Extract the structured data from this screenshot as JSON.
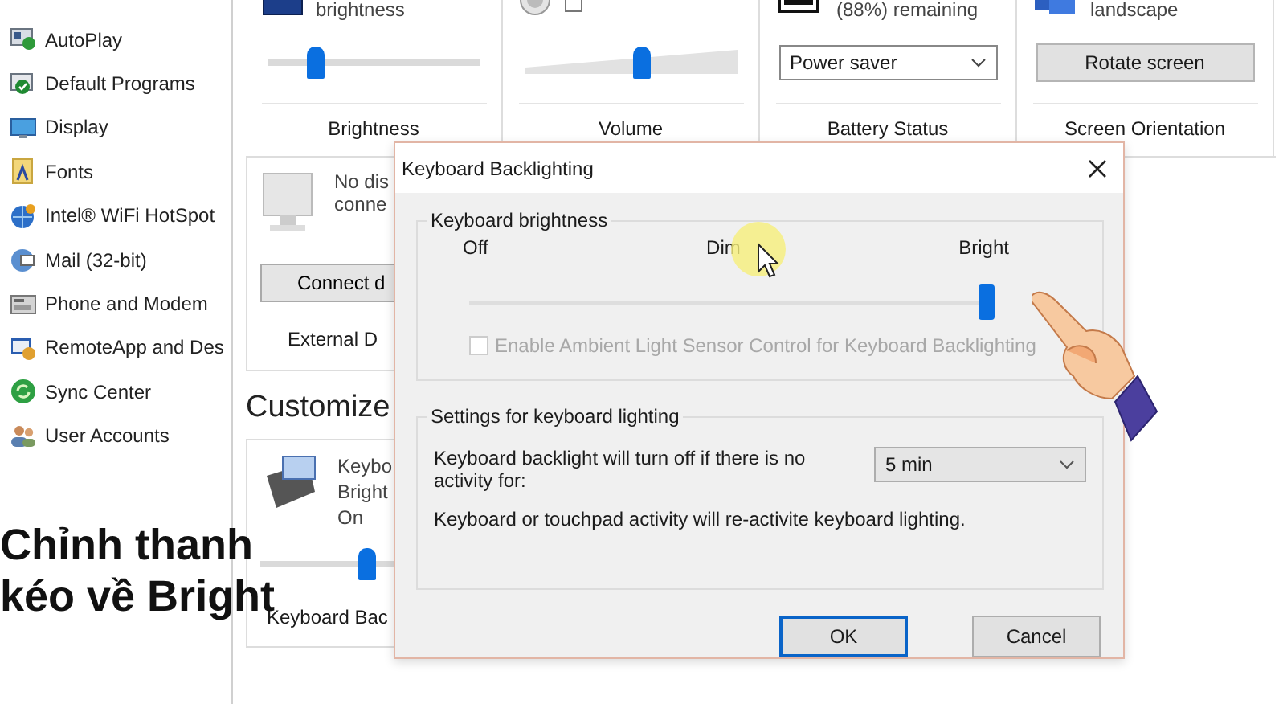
{
  "sidebar": {
    "items": [
      {
        "label": "AutoPlay"
      },
      {
        "label": "Default Programs"
      },
      {
        "label": "Display"
      },
      {
        "label": "Fonts"
      },
      {
        "label": "Intel® WiFi HotSpot"
      },
      {
        "label": "Mail (32-bit)"
      },
      {
        "label": "Phone and Modem"
      },
      {
        "label": "RemoteApp and Des"
      },
      {
        "label": "Sync Center"
      },
      {
        "label": "User Accounts"
      }
    ]
  },
  "tiles": [
    {
      "kind": "brightness",
      "status": "brightness",
      "level": 0.22,
      "label": "Brightness"
    },
    {
      "kind": "volume",
      "muted": false,
      "level": 0.55,
      "label": "Volume"
    },
    {
      "kind": "battery",
      "status": "(88%) remaining",
      "value": "Power saver",
      "label": "Battery Status"
    },
    {
      "kind": "orientation",
      "status": "landscape",
      "button": "Rotate screen",
      "label": "Screen Orientation"
    }
  ],
  "external_display": {
    "status": [
      "No dis",
      "conne"
    ],
    "button": "Connect d",
    "label": "External D"
  },
  "heading": "Customize",
  "keyboard_tile": {
    "status": [
      "Keybo",
      "Bright",
      "On"
    ],
    "level": 0.5,
    "label": "Keyboard Bac"
  },
  "dialog": {
    "title": "Keyboard Backlighting",
    "brightness_group": {
      "title": "Keyboard brightness",
      "marks": [
        "Off",
        "Dim",
        "Bright"
      ],
      "level": 1,
      "ambient": {
        "label": "Enable Ambient Light Sensor Control for Keyboard Backlighting",
        "checked": false,
        "disabled": true
      }
    },
    "settings_group": {
      "title": "Settings for keyboard lighting",
      "timeout_label": "Keyboard backlight will turn off if there is no activity for:",
      "timeout_value": "5 min",
      "note": "Keyboard or touchpad activity will re-activite keyboard lighting."
    },
    "buttons": [
      {
        "label": "OK",
        "default": true
      },
      {
        "label": "Cancel",
        "default": false
      }
    ]
  },
  "caption": {
    "lines": [
      "Chỉnh thanh",
      "kéo về Bright"
    ]
  }
}
